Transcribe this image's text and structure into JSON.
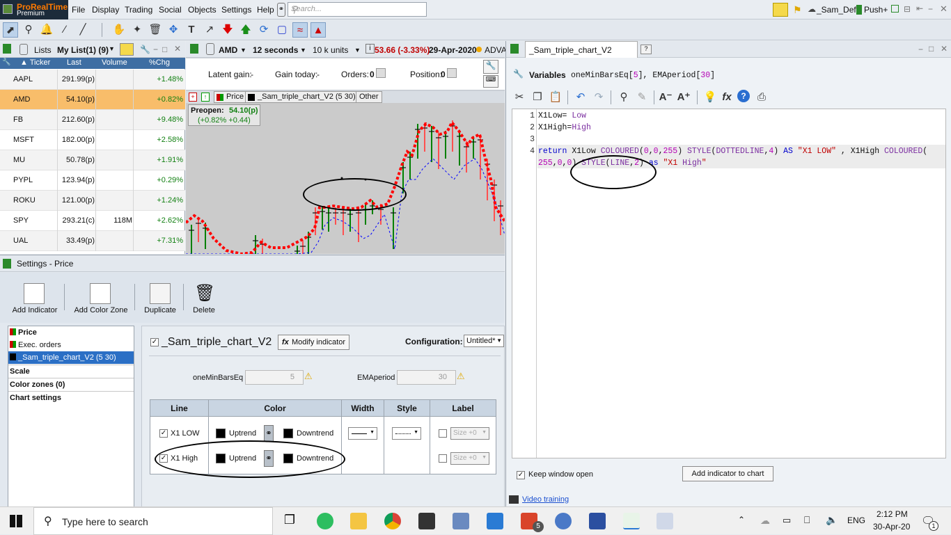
{
  "app": {
    "logo_line1": "ProRealTime",
    "logo_line2": "Premium",
    "menus": [
      "File",
      "Display",
      "Trading",
      "Social",
      "Objects",
      "Settings",
      "Help"
    ],
    "search_placeholder": "Search...",
    "user": "_Sam_Def",
    "push": "Push+"
  },
  "watchlist": {
    "lists_label": "Lists",
    "list_name": "My List(1) (9)",
    "columns": [
      "Ticker",
      "Last",
      "Volume",
      "%Chg"
    ],
    "rows": [
      {
        "ticker": "AAPL",
        "last": "291.99(p)",
        "volume": "",
        "chg": "+1.48%"
      },
      {
        "ticker": "AMD",
        "last": "54.10(p)",
        "volume": "",
        "chg": "+0.82%"
      },
      {
        "ticker": "FB",
        "last": "212.60(p)",
        "volume": "",
        "chg": "+9.48%"
      },
      {
        "ticker": "MSFT",
        "last": "182.00(p)",
        "volume": "",
        "chg": "+2.58%"
      },
      {
        "ticker": "MU",
        "last": "50.78(p)",
        "volume": "",
        "chg": "+1.91%"
      },
      {
        "ticker": "PYPL",
        "last": "123.94(p)",
        "volume": "",
        "chg": "+0.29%"
      },
      {
        "ticker": "ROKU",
        "last": "121.00(p)",
        "volume": "",
        "chg": "+1.24%"
      },
      {
        "ticker": "SPY",
        "last": "293.21(c)",
        "volume": "118M",
        "chg": "+2.62%"
      },
      {
        "ticker": "UAL",
        "last": "33.49(p)",
        "volume": "",
        "chg": "+7.31%"
      }
    ]
  },
  "chart": {
    "symbol": "AMD",
    "timeframe": "12 seconds",
    "units": "10 k units",
    "price_change": "53.66 (-3.33%)",
    "date": "29-Apr-2020",
    "adv": "ADVA",
    "latent_gain_label": "Latent gain:",
    "latent_gain_value": "-",
    "gain_today_label": "Gain today:",
    "gain_today_value": "-",
    "orders_label": "Orders:",
    "orders_value": "0",
    "position_label": "Position:",
    "position_value": "0",
    "tabs": [
      "Price",
      "_Sam_triple_chart_V2 (5 30)",
      "Other"
    ],
    "preopen_label": "Preopen:",
    "preopen_value": "54.10(p)",
    "preopen_change": "(+0.82% +0.44)",
    "colors": {
      "low_line": "#0000ff",
      "high_line": "#ff0000",
      "up_bar": "#008000",
      "down_bar": "#ff5050"
    }
  },
  "settings": {
    "title": "Settings - Price",
    "tools": [
      "Add Indicator",
      "Add Color Zone",
      "Duplicate",
      "Delete"
    ],
    "tree": {
      "items": [
        "Price",
        "Exec. orders",
        "_Sam_triple_chart_V2 (5 30)"
      ],
      "sections": [
        "Scale",
        "Color zones (0)",
        "Chart settings"
      ]
    },
    "indicator_name": "_Sam_triple_chart_V2",
    "modify_button": "Modify indicator",
    "configuration_label": "Configuration:",
    "configuration_value": "Untitled*",
    "params": [
      {
        "name": "oneMinBarsEq",
        "value": "5"
      },
      {
        "name": "EMAperiod",
        "value": "30"
      }
    ],
    "table_headers": [
      "Line",
      "Color",
      "Width",
      "Style",
      "Label"
    ],
    "lines": [
      {
        "name": "X1 LOW",
        "uptrend": "Uptrend",
        "downtrend": "Downtrend",
        "label": "Size +0"
      },
      {
        "name": "X1 High",
        "uptrend": "Uptrend",
        "downtrend": "Downtrend",
        "label": "Size +0"
      }
    ]
  },
  "editor": {
    "tab_title": "_Sam_triple_chart_V2",
    "variables_label": "Variables",
    "variables_text": "oneMinBarsEq[5], EMAperiod[30]",
    "code_lines": [
      {
        "num": "1",
        "text": "X1Low= Low"
      },
      {
        "num": "2",
        "text": "X1High=High"
      },
      {
        "num": "3",
        "text": ""
      },
      {
        "num": "4",
        "text": "return X1Low COLOURED(0,0,255) STYLE(DOTTEDLINE,4) AS \"X1 LOW\" , X1High COLOURED("
      },
      {
        "num": "",
        "text": "255,0,0) STYLE(LINE,2) as \"X1 High\""
      }
    ],
    "keep_open": "Keep window open",
    "add_button": "Add indicator to chart",
    "video_link": "Video training"
  },
  "taskbar": {
    "search_text": "Type here to search",
    "lang": "ENG",
    "time": "2:12 PM",
    "date": "30-Apr-20",
    "notif_count": "1",
    "badge_count": "5"
  }
}
